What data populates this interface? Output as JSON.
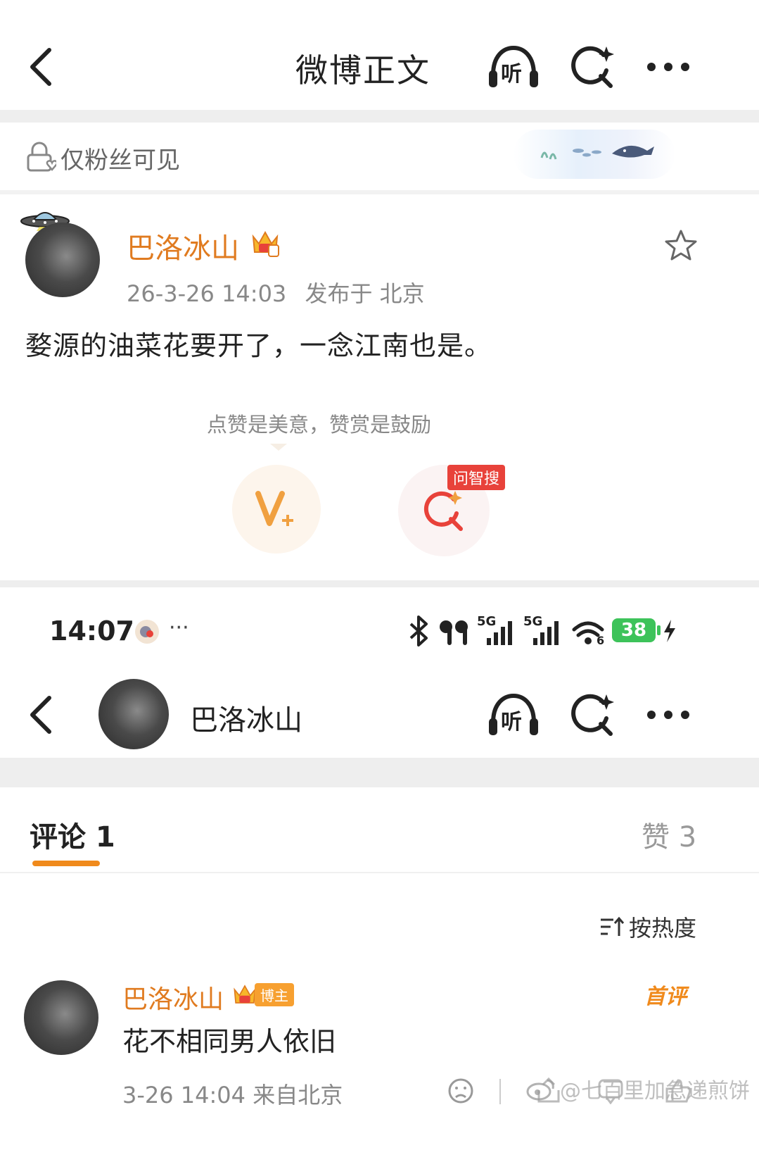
{
  "top_header": {
    "title": "微博正文",
    "listen_label": "听"
  },
  "visibility": {
    "label": "仅粉丝可见"
  },
  "post": {
    "author": "巴洛冰山",
    "meta_time": "26-3-26 14:03",
    "meta_location": "发布于 北京",
    "content": "婺源的油菜花要开了，一念江南也是。",
    "reward_hint": "点赞是美意，赞赏是鼓励",
    "ai_search_badge": "问智搜"
  },
  "status_bar": {
    "time": "14:07",
    "dots": "···",
    "net1": "5G",
    "net2": "5G",
    "wifi_sub": "6",
    "battery": "38"
  },
  "profile_header": {
    "name": "巴洛冰山",
    "listen_label": "听"
  },
  "tabs": {
    "comments": "评论 1",
    "likes": "赞 3"
  },
  "sort": {
    "label": "按热度"
  },
  "comment": {
    "author": "巴洛冰山",
    "author_badge": "博主",
    "first_tag": "首评",
    "text": "花不相同男人依旧",
    "meta": "3-26 14:04 来自北京"
  },
  "watermark": {
    "text": "@七百里加急递煎饼"
  },
  "colors": {
    "accent": "#e07b20",
    "tab_underline": "#f08a1c",
    "badge_red": "#e8423a"
  }
}
